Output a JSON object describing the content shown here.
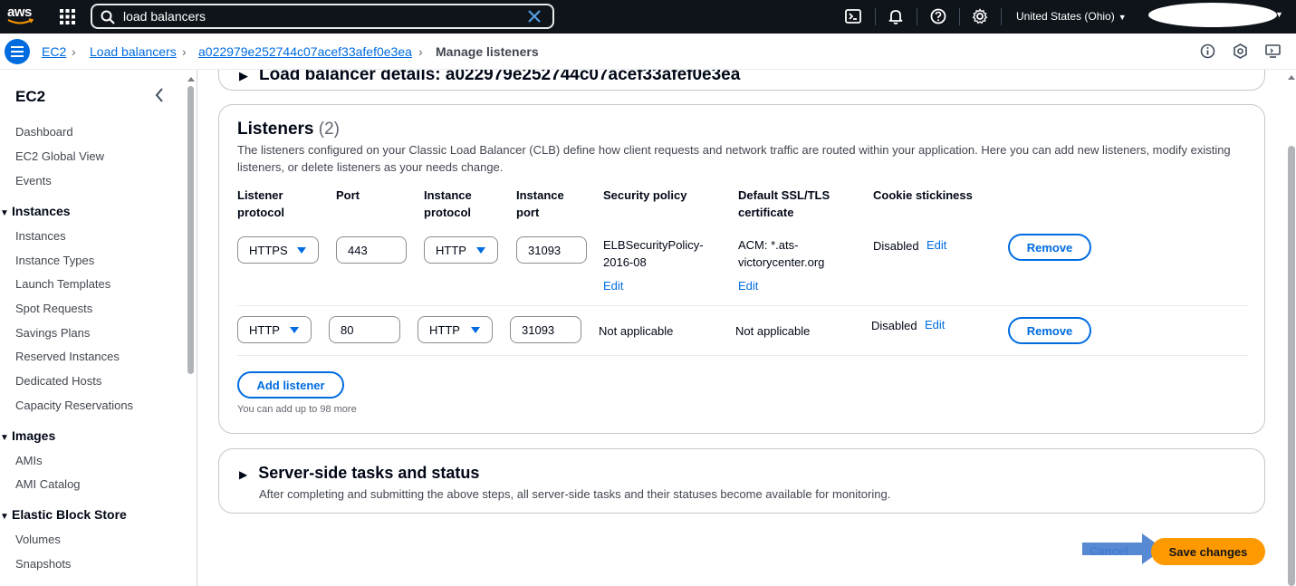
{
  "topnav": {
    "logo_text": "aws",
    "search_value": "load balancers",
    "region_label": "United States (Ohio)",
    "icons": [
      "grid-icon",
      "search-icon",
      "close-icon",
      "cloudshell-icon",
      "bell-icon",
      "help-icon",
      "gear-icon"
    ]
  },
  "breadcrumb": {
    "items": [
      "EC2",
      "Load balancers",
      "a022979e252744c07acef33afef0e3ea"
    ],
    "current": "Manage listeners",
    "right_icons": [
      "info-icon",
      "feedback-icon",
      "screen-icon"
    ]
  },
  "sidebar": {
    "title": "EC2",
    "top_items": [
      "Dashboard",
      "EC2 Global View",
      "Events"
    ],
    "sections": [
      {
        "label": "Instances",
        "items": [
          "Instances",
          "Instance Types",
          "Launch Templates",
          "Spot Requests",
          "Savings Plans",
          "Reserved Instances",
          "Dedicated Hosts",
          "Capacity Reservations"
        ]
      },
      {
        "label": "Images",
        "items": [
          "AMIs",
          "AMI Catalog"
        ]
      },
      {
        "label": "Elastic Block Store",
        "items": [
          "Volumes",
          "Snapshots"
        ]
      }
    ]
  },
  "details_section": {
    "title": "Load balancer details: a022979e252744c07acef33afef0e3ea"
  },
  "listeners": {
    "title": "Listeners",
    "count": "(2)",
    "description": "The listeners configured on your Classic Load Balancer (CLB) define how client requests and network traffic are routed within your application. Here you can add new listeners, modify existing listeners, or delete listeners as your needs change.",
    "columns": {
      "listener_protocol": [
        "Listener",
        "protocol"
      ],
      "port": "Port",
      "instance_protocol": [
        "Instance",
        "protocol"
      ],
      "instance_port": [
        "Instance",
        "port"
      ],
      "security_policy": "Security policy",
      "ssl_cert": [
        "Default SSL/TLS",
        "certificate"
      ],
      "cookie": "Cookie stickiness"
    },
    "rows": [
      {
        "listener_protocol": "HTTPS",
        "port": "443",
        "instance_protocol": "HTTP",
        "instance_port": "31093",
        "security_policy": [
          "ELBSecurityPolicy-",
          "2016-08"
        ],
        "security_edit": "Edit",
        "ssl_cert": [
          "ACM: *.ats-",
          "victorycenter.org"
        ],
        "ssl_edit": "Edit",
        "cookie": "Disabled",
        "cookie_edit": "Edit",
        "remove_label": "Remove"
      },
      {
        "listener_protocol": "HTTP",
        "port": "80",
        "instance_protocol": "HTTP",
        "instance_port": "31093",
        "security_policy": "Not applicable",
        "ssl_cert": "Not applicable",
        "cookie": "Disabled",
        "cookie_edit": "Edit",
        "remove_label": "Remove"
      }
    ],
    "add_label": "Add listener",
    "add_hint": "You can add up to 98 more"
  },
  "server_section": {
    "title": "Server-side tasks and status",
    "description": "After completing and submitting the above steps, all server-side tasks and their statuses become available for monitoring."
  },
  "footer": {
    "cancel_label": "Cancel",
    "save_label": "Save changes"
  },
  "colors": {
    "nav_bg": "#0f141a",
    "link": "#006ce0",
    "primary_button": "#ff9900",
    "annotation_arrow": "#4a7fcf"
  }
}
